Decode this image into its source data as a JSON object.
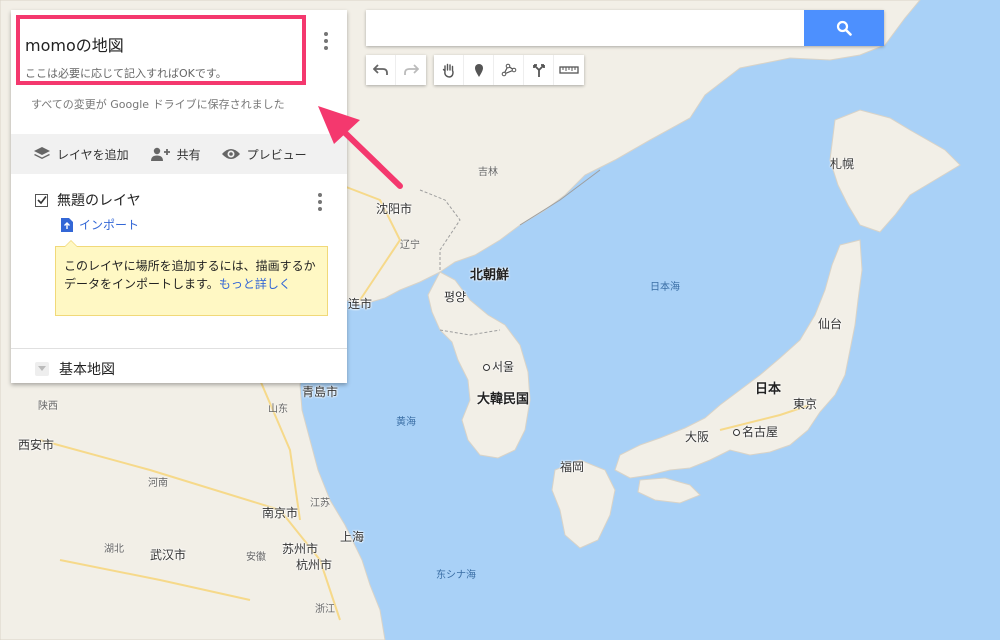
{
  "search": {
    "value": "",
    "placeholder": ""
  },
  "panel": {
    "title": "momoの地図",
    "description": "ここは必要に応じて記入すればOKです。",
    "saved_status": "すべての変更が Google ドライブに保存されました",
    "actions": {
      "add_layer": "レイヤを追加",
      "share": "共有",
      "preview": "プレビュー"
    },
    "layer": {
      "name": "無題のレイヤ",
      "checked": true,
      "import_label": "インポート"
    },
    "tooltip": {
      "text": "このレイヤに場所を追加するには、描画するかデータをインポートします。",
      "link": "もっと詳しく"
    },
    "base_map_label": "基本地図"
  },
  "toolbar": [
    "undo-icon",
    "redo-icon",
    "hand-icon",
    "marker-icon",
    "draw-line-icon",
    "directions-icon",
    "ruler-icon"
  ],
  "colors": {
    "accent": "#4d90fe",
    "highlight": "#f4386e",
    "sea": "#a9d1f7",
    "land": "#f2efe7"
  },
  "map": {
    "countries": {
      "north_korea": "北朝鮮",
      "south_korea": "大韓民国",
      "japan": "日本"
    },
    "cities": {
      "shenyang": "沈阳市",
      "dalian": "连市",
      "pyongyang": "평양",
      "seoul": "서울",
      "sapporo": "札幌",
      "sendai": "仙台",
      "tokyo": "東京",
      "nagoya": "名古屋",
      "osaka": "大阪",
      "fukuoka": "福岡",
      "qingdao": "青島市",
      "xian": "西安市",
      "nanjing": "南京市",
      "shanghai": "上海",
      "suzhou": "苏州市",
      "hangzhou": "杭州市",
      "wuhan": "武汉市"
    },
    "provinces": {
      "jilin": "吉林",
      "liaoning": "辽宁",
      "shaanxi": "陕西",
      "shandong": "山东",
      "henan": "河南",
      "jiangsu": "江苏",
      "hubei": "湖北",
      "anhui": "安徽",
      "zhejiang": "浙江"
    },
    "seas": {
      "sea_of_japan": "日本海",
      "yellow_sea": "黄海",
      "east_china_sea": "东シナ海"
    }
  }
}
